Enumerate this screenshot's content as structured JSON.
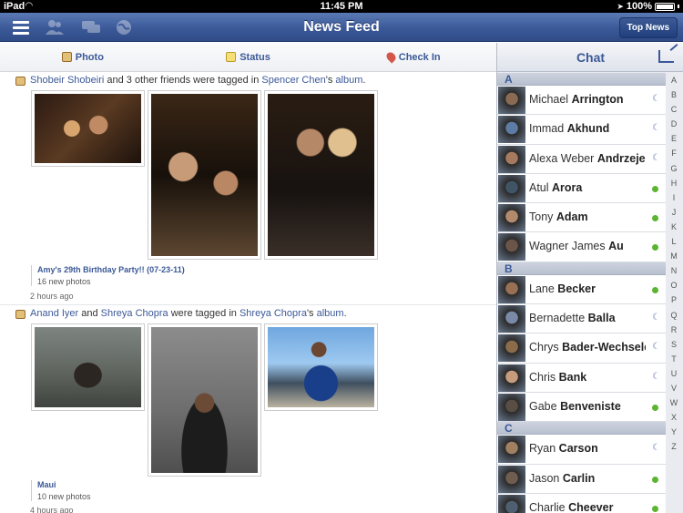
{
  "status_bar": {
    "carrier": "iPad",
    "time": "11:45 PM",
    "battery": "100%"
  },
  "nav": {
    "title": "News Feed",
    "top_news_label": "Top News"
  },
  "publisher": {
    "photo": "Photo",
    "status": "Status",
    "checkin": "Check In"
  },
  "stories": [
    {
      "actor": "Shobeir Shobeiri",
      "middle": " and 3 other friends were tagged in ",
      "owner": "Spencer Chen",
      "suffix": "'s ",
      "target": "album",
      "end": ".",
      "album_title": "Amy's 29th Birthday Party!! (07-23-11)",
      "photo_count": "16 new photos",
      "time": "2 hours ago"
    },
    {
      "actor": "Anand Iyer",
      "middle_a": " and ",
      "actor2": "Shreya Chopra",
      "middle": " were tagged in ",
      "owner": "Shreya Chopra",
      "suffix": "'s ",
      "target": "album",
      "end": ".",
      "album_title": "Maui",
      "photo_count": "10 new photos",
      "time": "4 hours ago"
    }
  ],
  "chat": {
    "title": "Chat",
    "sections": [
      {
        "letter": "A",
        "contacts": [
          {
            "first": "Michael",
            "last": "Arrington",
            "status": "idle"
          },
          {
            "first": "Immad",
            "last": "Akhund",
            "status": "idle"
          },
          {
            "first": "Alexa Weber",
            "last": "Andrzeje...",
            "status": "idle"
          },
          {
            "first": "Atul",
            "last": "Arora",
            "status": "online"
          },
          {
            "first": "Tony",
            "last": "Adam",
            "status": "online"
          },
          {
            "first": "Wagner James",
            "last": "Au",
            "status": "online"
          }
        ]
      },
      {
        "letter": "B",
        "contacts": [
          {
            "first": "Lane",
            "last": "Becker",
            "status": "online"
          },
          {
            "first": "Bernadette",
            "last": "Balla",
            "status": "idle"
          },
          {
            "first": "Chrys",
            "last": "Bader-Wechseler",
            "status": "idle"
          },
          {
            "first": "Chris",
            "last": "Bank",
            "status": "idle"
          },
          {
            "first": "Gabe",
            "last": "Benveniste",
            "status": "online"
          }
        ]
      },
      {
        "letter": "C",
        "contacts": [
          {
            "first": "Ryan",
            "last": "Carson",
            "status": "idle"
          },
          {
            "first": "Jason",
            "last": "Carlin",
            "status": "online"
          },
          {
            "first": "Charlie",
            "last": "Cheever",
            "status": "online"
          }
        ]
      }
    ],
    "index": [
      "A",
      "B",
      "C",
      "D",
      "E",
      "F",
      "G",
      "H",
      "I",
      "J",
      "K",
      "L",
      "M",
      "N",
      "O",
      "P",
      "Q",
      "R",
      "S",
      "T",
      "U",
      "V",
      "W",
      "X",
      "Y",
      "Z"
    ]
  }
}
